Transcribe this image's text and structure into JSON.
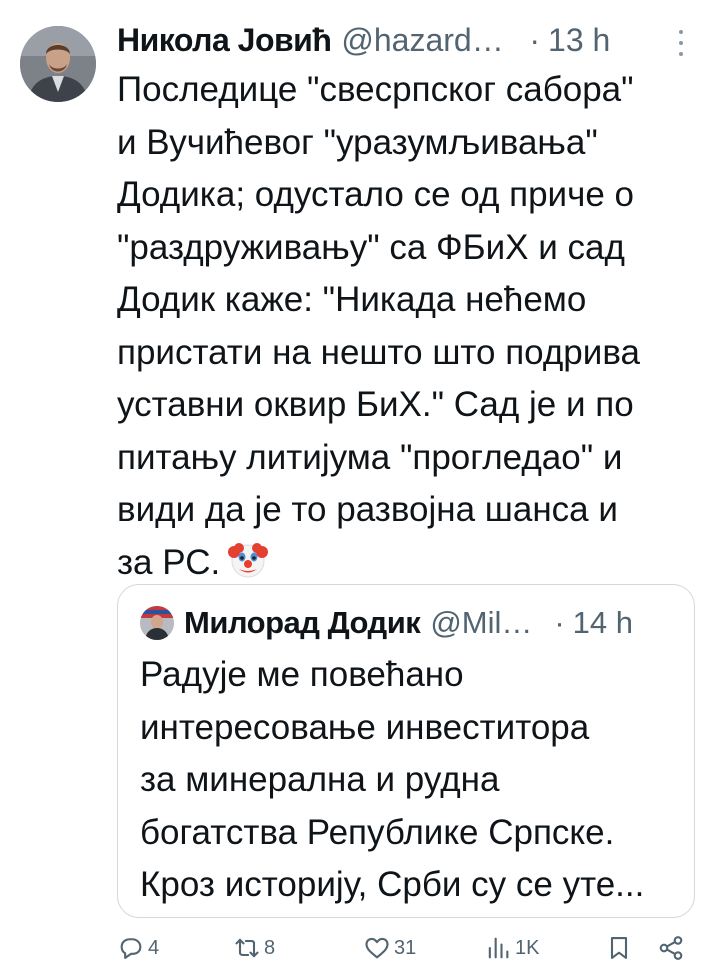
{
  "tweet": {
    "author_name": "Никола Јовић",
    "handle": "@hazardous",
    "separator": "·",
    "time": "13 h",
    "text_lines": [
      "Последице \"свесрпског сабора\"",
      "и Вучићевог \"уразумљивања\"",
      "Додика; одустало се од приче о",
      "\"раздруживању\" са ФБиХ и сад",
      "Додик каже: \"Никада нећемо",
      "пристати на нешто што подрива",
      "уставни оквир БиХ.\" Сад је и по",
      "питању литијума \"прогледао\" и",
      "види да је то развојна шанса и",
      "за РС."
    ],
    "emoji": "clown-face-emoji"
  },
  "quote": {
    "author_name": "Милорад Додик",
    "handle": "@MiloradDodik",
    "separator": "·",
    "time": "14 h",
    "text_lines": [
      "Радује ме повећано",
      "интересовање инвеститора",
      "за минерална и рудна",
      "богатства Републике Српске.",
      "Кроз историју, Срби су се уте..."
    ]
  },
  "actions": {
    "replies": "4",
    "reposts": "8",
    "likes": "31",
    "views": "1K"
  },
  "icons": {
    "reply": "reply-icon",
    "repost": "repost-icon",
    "like": "heart-icon",
    "views": "views-chart-icon",
    "bookmark": "bookmark-icon",
    "share": "share-icon",
    "more": "more-icon"
  },
  "colors": {
    "text": "#0f1419",
    "secondary": "#536471",
    "border": "#cfd9de"
  }
}
